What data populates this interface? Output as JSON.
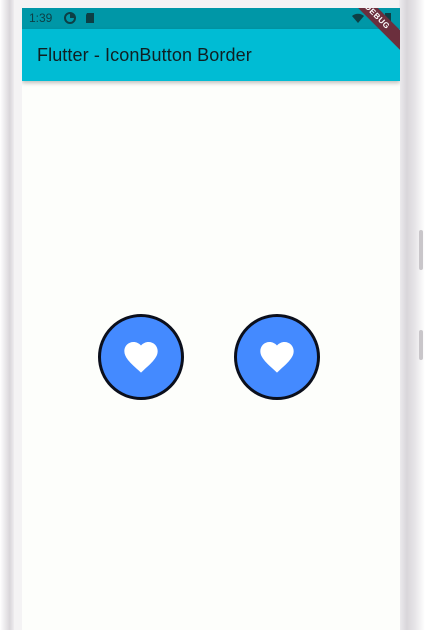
{
  "status_bar": {
    "time": "1:39",
    "icons": [
      "data-saver-icon",
      "sd-card-icon",
      "wifi-icon",
      "battery-icon"
    ],
    "color": "#0097a7"
  },
  "app_bar": {
    "title": "Flutter - IconButton Border",
    "color": "#00bcd4"
  },
  "debug_banner": {
    "label": "DEBUG"
  },
  "buttons": [
    {
      "icon": "favorite-icon",
      "fill": "#448aff",
      "border": "#0b0f1c"
    },
    {
      "icon": "favorite-icon",
      "fill": "#448aff",
      "border": "#0b0f1c"
    }
  ],
  "colors": {
    "background": "#fdfefb",
    "icon": "#ffffff"
  }
}
